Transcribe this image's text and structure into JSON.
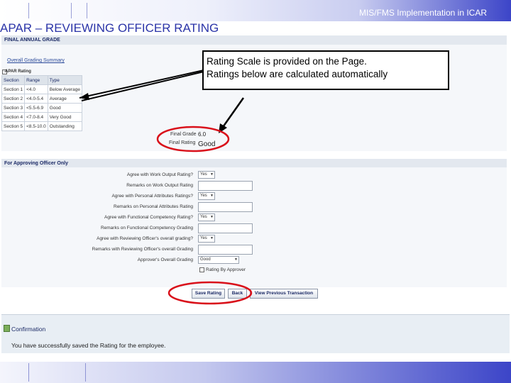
{
  "header_text": "MIS/FMS Implementation in ICAR",
  "slide_title": "APAR – REVIEWING OFFICER RATING",
  "final_grade": {
    "section_title": "FINAL ANNUAL GRADE",
    "overall_link": "Overall Grading Summary",
    "apar_rating_label": "APAR Rating",
    "table": {
      "headers": [
        "Section",
        "Range",
        "Type"
      ],
      "rows": [
        [
          "Section 1",
          "<4.0",
          "Below Average"
        ],
        [
          "Section 2",
          "<4.0-5.4",
          "Average"
        ],
        [
          "Section 3",
          "<5.5-6.9",
          "Good"
        ],
        [
          "Section 4",
          "<7.0-8.4",
          "Very Good"
        ],
        [
          "Section 5",
          "<8.5-10.0",
          "Outstanding"
        ]
      ]
    },
    "final_grade_label": "Final Grade",
    "final_grade_value": "6.0",
    "final_rating_label": "Final Rating",
    "final_rating_value": "Good"
  },
  "approving": {
    "section_title": "For Approving Officer Only",
    "fields": [
      {
        "label": "Agree with Work Output Rating?",
        "value": "Yes"
      },
      {
        "label": "Remarks on Work Output Rating",
        "value": ""
      },
      {
        "label": "Agree with Personal Attributes Ratings?",
        "value": "Yes"
      },
      {
        "label": "Remarks on Personal Attributes Rating",
        "value": ""
      },
      {
        "label": "Agree with Functional Competency Rating?",
        "value": "Yes"
      },
      {
        "label": "Remarks on Functional Competency Grading",
        "value": ""
      },
      {
        "label": "Agree with Reviewing Officer's overall grading?",
        "value": "Yes"
      },
      {
        "label": "Remarks with Reviewing Officer's overall Grading",
        "value": ""
      },
      {
        "label": "Approver's Overall Grading",
        "value": "Good"
      }
    ],
    "checkbox_label": "Rating By Approver",
    "buttons": {
      "save": "Save Rating",
      "back": "Back",
      "view_previous": "View Previous Transaction"
    }
  },
  "callout": {
    "line1": "Rating Scale is provided on the Page.",
    "line2": "Ratings below are calculated automatically"
  },
  "confirmation": {
    "title": "Confirmation",
    "message": "You have successfully saved the Rating for the employee."
  },
  "colors": {
    "band_blue": "#3c45c8",
    "title_blue": "#2b34a8",
    "highlight_red": "#d9101a"
  }
}
